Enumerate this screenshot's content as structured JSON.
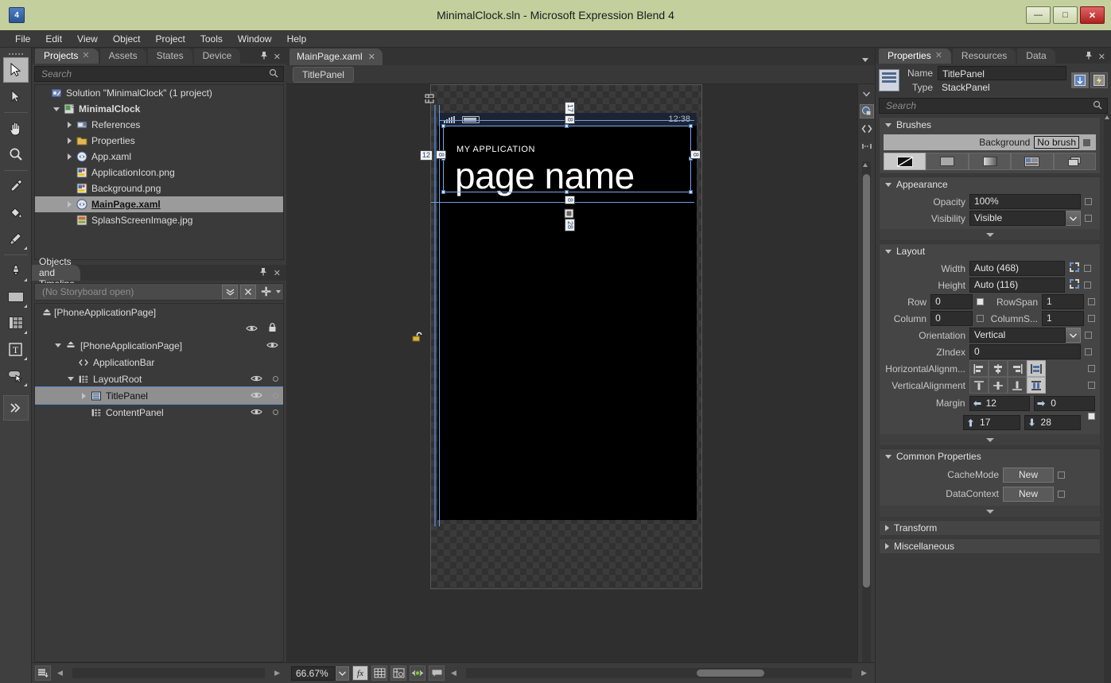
{
  "window": {
    "title": "MinimalClock.sln - Microsoft Expression Blend 4",
    "app_badge": "4",
    "minimize": "—",
    "maximize": "□",
    "close": "✕"
  },
  "menu": [
    "File",
    "Edit",
    "View",
    "Object",
    "Project",
    "Tools",
    "Window",
    "Help"
  ],
  "toolbox": [
    {
      "name": "selection-tool",
      "active": true
    },
    {
      "name": "direct-selection-tool",
      "active": false
    },
    {
      "name": "pan-tool",
      "active": false
    },
    {
      "name": "zoom-tool",
      "active": false
    },
    {
      "name": "eyedropper-tool",
      "active": false
    },
    {
      "name": "paint-bucket-tool",
      "active": false
    },
    {
      "name": "brush-tool",
      "active": false
    },
    {
      "name": "pen-tool",
      "active": false
    },
    {
      "name": "rectangle-tool",
      "active": false
    },
    {
      "name": "grid-tool",
      "active": false
    },
    {
      "name": "text-tool",
      "active": false
    },
    {
      "name": "control-tool",
      "active": false
    },
    {
      "name": "more-tools",
      "active": false
    }
  ],
  "left_dock": {
    "tabs": [
      {
        "label": "Projects",
        "active": true,
        "closable": true
      },
      {
        "label": "Assets",
        "active": false,
        "closable": false
      },
      {
        "label": "States",
        "active": false,
        "closable": false
      },
      {
        "label": "Device",
        "active": false,
        "closable": false
      }
    ],
    "search_placeholder": "Search",
    "search_value": "",
    "tree": [
      {
        "label": "Solution \"MinimalClock\" (1 project)",
        "indent": 0,
        "twisty": "none",
        "icon": "solution-icon",
        "bold": false,
        "selected": false
      },
      {
        "label": "MinimalClock",
        "indent": 1,
        "twisty": "down",
        "icon": "csharp-project-icon",
        "bold": true,
        "selected": false
      },
      {
        "label": "References",
        "indent": 2,
        "twisty": "right",
        "icon": "references-icon",
        "bold": false,
        "selected": false
      },
      {
        "label": "Properties",
        "indent": 2,
        "twisty": "right",
        "icon": "folder-icon",
        "bold": false,
        "selected": false
      },
      {
        "label": "App.xaml",
        "indent": 2,
        "twisty": "right",
        "icon": "xaml-icon",
        "bold": false,
        "selected": false
      },
      {
        "label": "ApplicationIcon.png",
        "indent": 2,
        "twisty": "none",
        "icon": "image-icon",
        "bold": false,
        "selected": false
      },
      {
        "label": "Background.png",
        "indent": 2,
        "twisty": "none",
        "icon": "image-icon",
        "bold": false,
        "selected": false
      },
      {
        "label": "MainPage.xaml",
        "indent": 2,
        "twisty": "right",
        "icon": "xaml-icon",
        "bold": true,
        "selected": true
      },
      {
        "label": "SplashScreenImage.jpg",
        "indent": 2,
        "twisty": "none",
        "icon": "jpg-icon",
        "bold": false,
        "selected": false
      }
    ]
  },
  "objects_panel": {
    "title": "Objects and Timeline",
    "storyboard_text": "(No Storyboard open)",
    "scope_label": "[PhoneApplicationPage]",
    "tree": [
      {
        "label": "[PhoneApplicationPage]",
        "indent": 0,
        "twisty": "down",
        "icon": "page-icon",
        "selected": false,
        "eye": true,
        "lock_dot": false
      },
      {
        "label": "ApplicationBar",
        "indent": 1,
        "twisty": "none",
        "icon": "appbar-icon",
        "selected": false,
        "eye": false,
        "lock_dot": false
      },
      {
        "label": "LayoutRoot",
        "indent": 1,
        "twisty": "down",
        "icon": "grid-icon",
        "selected": false,
        "eye": true,
        "lock_dot": true
      },
      {
        "label": "TitlePanel",
        "indent": 2,
        "twisty": "right",
        "icon": "stackpanel-icon",
        "selected": true,
        "eye": true,
        "lock_dot": true
      },
      {
        "label": "ContentPanel",
        "indent": 2,
        "twisty": "none",
        "icon": "grid-icon",
        "selected": false,
        "eye": true,
        "lock_dot": true
      }
    ]
  },
  "document": {
    "tab_label": "MainPage.xaml",
    "tab_close": "✕",
    "breadcrumb": "TitlePanel"
  },
  "artboard": {
    "phone": {
      "status_time": "12:38",
      "app_title": "MY APPLICATION",
      "page_name": "page name"
    },
    "margin_badges": {
      "top": "17",
      "left": "12",
      "inner_top": "8",
      "inner_bottom": "8",
      "inner_left": "8",
      "inner_right": "8",
      "bottom": "28"
    }
  },
  "status_bar": {
    "zoom": "66.67%",
    "buttons": [
      {
        "name": "effects-button",
        "glyph": "fx",
        "on": true
      },
      {
        "name": "show-grid-button",
        "glyph": "grid",
        "on": false
      },
      {
        "name": "snap-to-gridlines-button",
        "glyph": "snapgrid",
        "on": false
      },
      {
        "name": "snap-to-snaplines-button",
        "glyph": "snapline",
        "on": false
      },
      {
        "name": "annotations-button",
        "glyph": "comment",
        "on": false
      }
    ]
  },
  "properties": {
    "tabs": [
      {
        "label": "Properties",
        "active": true,
        "closable": true
      },
      {
        "label": "Resources",
        "active": false,
        "closable": false
      },
      {
        "label": "Data",
        "active": false,
        "closable": false
      }
    ],
    "name_label": "Name",
    "name_value": "TitlePanel",
    "type_label": "Type",
    "type_value": "StackPanel",
    "search_placeholder": "Search",
    "search_value": "",
    "brushes": {
      "title": "Brushes",
      "background_label": "Background",
      "background_value": "No brush",
      "brush_types": [
        {
          "name": "no-brush-button",
          "on": true
        },
        {
          "name": "solid-color-brush-button",
          "on": false
        },
        {
          "name": "gradient-brush-button",
          "on": false
        },
        {
          "name": "tile-brush-button",
          "on": false
        },
        {
          "name": "brush-resources-button",
          "on": false
        }
      ]
    },
    "appearance": {
      "title": "Appearance",
      "opacity_label": "Opacity",
      "opacity_value": "100%",
      "visibility_label": "Visibility",
      "visibility_value": "Visible"
    },
    "layout": {
      "title": "Layout",
      "width_label": "Width",
      "width_value": "Auto (468)",
      "height_label": "Height",
      "height_value": "Auto (116)",
      "row_label": "Row",
      "row_value": "0",
      "rowspan_label": "RowSpan",
      "rowspan_value": "1",
      "column_label": "Column",
      "column_value": "0",
      "columnspan_label": "ColumnS...",
      "columnspan_value": "1",
      "orientation_label": "Orientation",
      "orientation_value": "Vertical",
      "zindex_label": "ZIndex",
      "zindex_value": "0",
      "halign_label": "HorizontalAlignm...",
      "valign_label": "VerticalAlignment",
      "margin_label": "Margin",
      "margin_left": "12",
      "margin_right": "0",
      "margin_top": "17",
      "margin_bottom": "28"
    },
    "common": {
      "title": "Common Properties",
      "cachemode_label": "CacheMode",
      "cachemode_button": "New",
      "datacontext_label": "DataContext",
      "datacontext_button": "New"
    },
    "transform_title": "Transform",
    "misc_title": "Miscellaneous"
  }
}
